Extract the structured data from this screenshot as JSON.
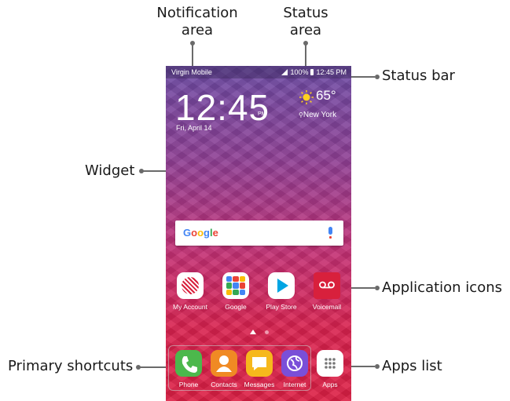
{
  "callouts": {
    "notification_area": "Notification\narea",
    "status_area": "Status\narea",
    "status_bar": "Status bar",
    "widget": "Widget",
    "application_icons": "Application icons",
    "primary_shortcuts": "Primary shortcuts",
    "apps_list": "Apps list"
  },
  "status_bar": {
    "carrier": "Virgin Mobile",
    "battery": "100%",
    "time": "12:45 PM"
  },
  "clock_widget": {
    "time": "12:45",
    "ampm": "PM",
    "date": "Fri, April 14"
  },
  "weather": {
    "temperature": "65°",
    "city": "New York"
  },
  "search": {
    "logo": "Google"
  },
  "apps": [
    {
      "label": "My Account",
      "icon": "my-account-icon"
    },
    {
      "label": "Google",
      "icon": "google-folder-icon"
    },
    {
      "label": "Play Store",
      "icon": "play-store-icon"
    },
    {
      "label": "Voicemail",
      "icon": "voicemail-icon"
    }
  ],
  "dock": [
    {
      "label": "Phone",
      "icon": "phone-icon"
    },
    {
      "label": "Contacts",
      "icon": "contacts-icon"
    },
    {
      "label": "Messages",
      "icon": "messages-icon"
    },
    {
      "label": "Internet",
      "icon": "internet-icon"
    },
    {
      "label": "Apps",
      "icon": "apps-grid-icon"
    }
  ],
  "colors": {
    "wallpaper_top": "#6b4aa3",
    "wallpaper_bottom": "#dc1f44",
    "callout_line": "#6a6a6a"
  }
}
